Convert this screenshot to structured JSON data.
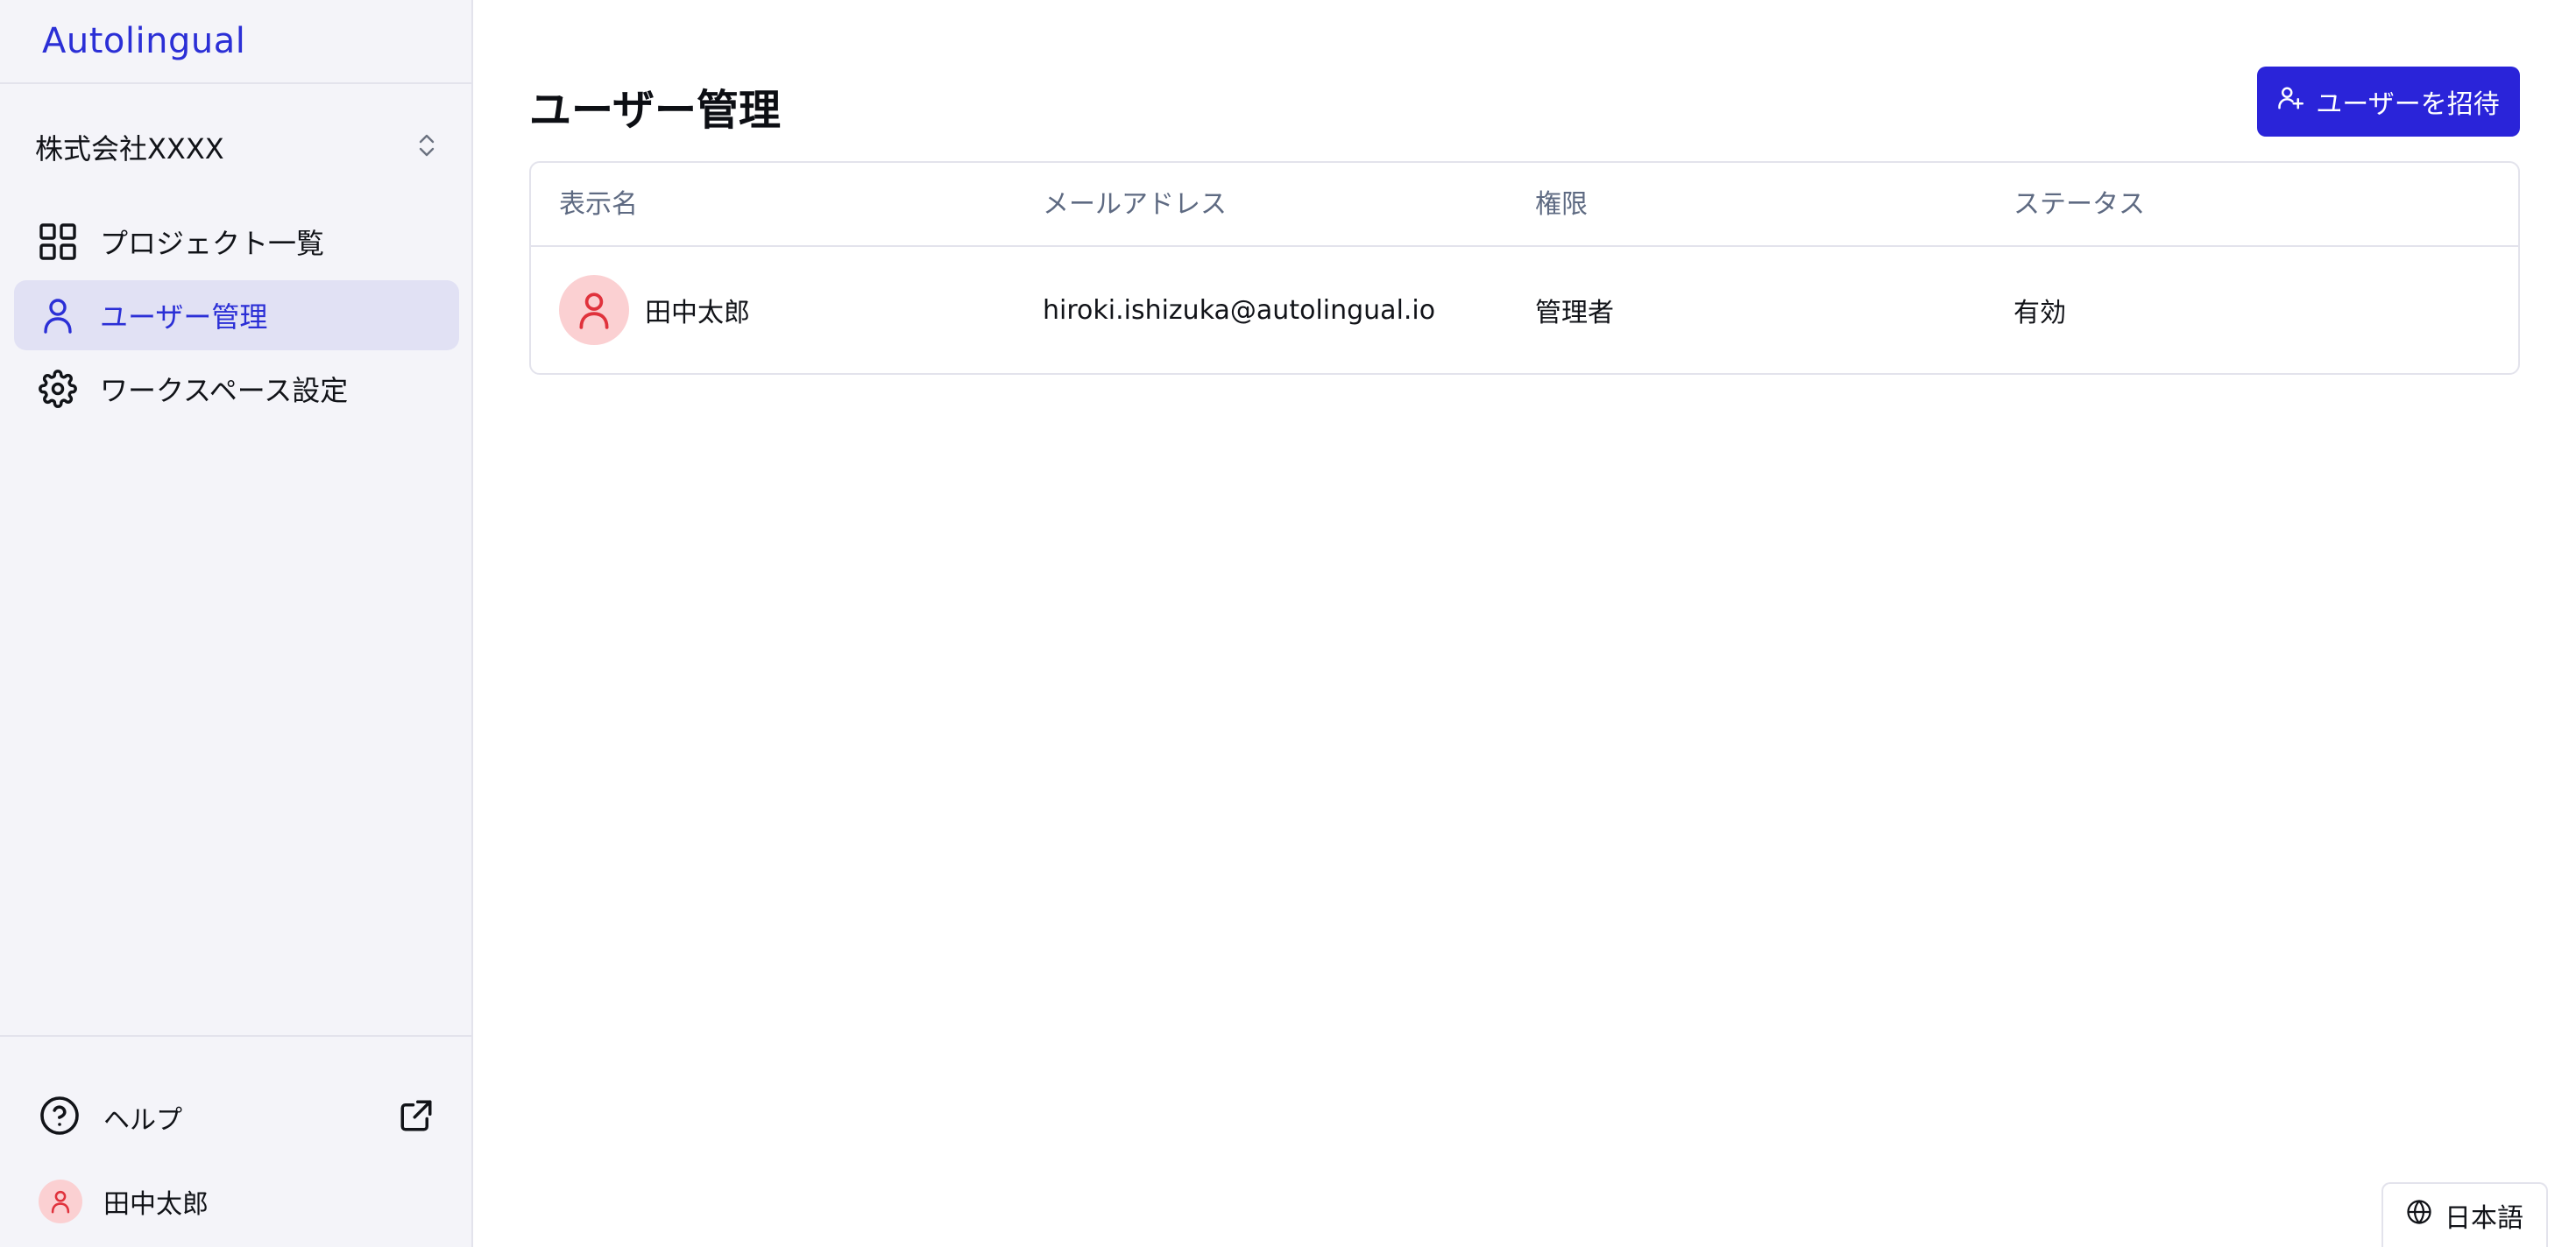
{
  "app": {
    "logo": "Autolingual"
  },
  "sidebar": {
    "workspace": "株式会社XXXX",
    "items": [
      {
        "label": "プロジェクト一覧",
        "icon": "grid-icon",
        "active": false
      },
      {
        "label": "ユーザー管理",
        "icon": "user-icon",
        "active": true
      },
      {
        "label": "ワークスペース設定",
        "icon": "gear-icon",
        "active": false
      }
    ],
    "help": {
      "label": "ヘルプ",
      "icon": "question-circle-icon",
      "external_icon": "external-link-icon"
    },
    "user": {
      "name": "田中太郎"
    }
  },
  "main": {
    "title": "ユーザー管理",
    "invite_button": "ユーザーを招待",
    "table": {
      "headers": [
        "表示名",
        "メールアドレス",
        "権限",
        "ステータス"
      ],
      "rows": [
        {
          "name": "田中太郎",
          "email": "hiroki.ishizuka@autolingual.io",
          "role": "管理者",
          "status": "有効"
        }
      ]
    }
  },
  "language": {
    "label": "日本語",
    "icon": "globe-icon"
  },
  "colors": {
    "accent": "#2a24d9",
    "sidebar_bg": "#f4f4f9",
    "active_item_bg": "#e1e1f4",
    "avatar_bg": "#fbd0d2",
    "avatar_icon": "#e0323c",
    "header_text": "#5e6a82"
  }
}
